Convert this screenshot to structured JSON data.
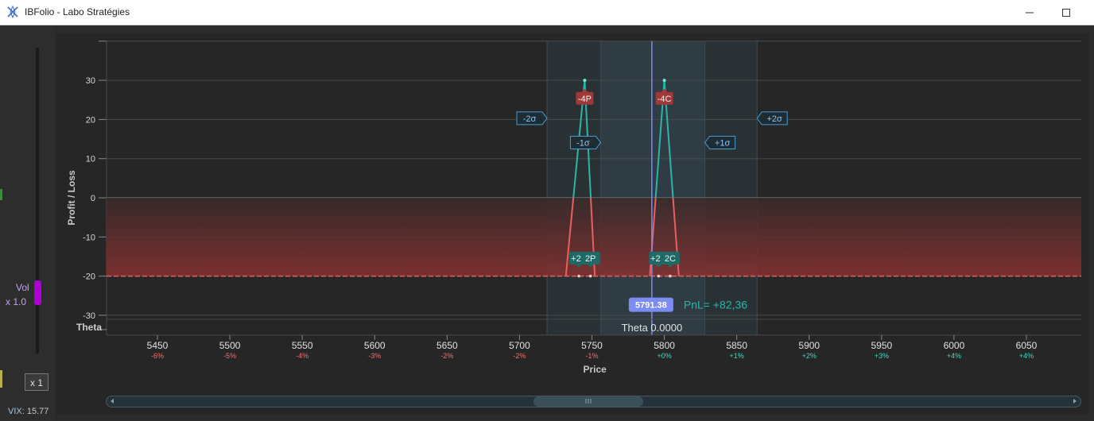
{
  "window": {
    "title": "IBFolio - Labo Stratégies",
    "minimize_icon": "minimize-icon",
    "maximize_icon": "maximize-icon",
    "app_icon": "ibfolio-logo-icon"
  },
  "left_panel": {
    "vol_label": "Vol",
    "vol_multiplier": "x 1.0",
    "vol_level": 0.27,
    "slider_color": "#b000d8",
    "x1_button": "x 1",
    "vix_label": "VIX:",
    "vix_value": "15.77"
  },
  "chart_data": {
    "type": "line",
    "ylabel": "Profit / Loss",
    "xlabel": "Price",
    "ylim": [
      -30,
      30
    ],
    "yticks": [
      30,
      20,
      10,
      0,
      -10,
      -20,
      -30
    ],
    "xlim": [
      5415,
      6090
    ],
    "xticks": [
      5450,
      5500,
      5550,
      5600,
      5650,
      5700,
      5750,
      5800,
      5850,
      5900,
      5950,
      6000,
      6050
    ],
    "xpct": [
      "-6%",
      "-5%",
      "-4%",
      "-3%",
      "-2%",
      "-2%",
      "-1%",
      "+0%",
      "+1%",
      "+2%",
      "+3%",
      "+4%",
      "+4%"
    ],
    "pnl_curve": {
      "x": [
        5415,
        5732,
        5745,
        5752,
        5787,
        5790,
        5800,
        5810,
        6090
      ],
      "y": [
        -20,
        -20,
        30,
        -20,
        -20,
        -20,
        30,
        -20,
        -20
      ]
    },
    "current_price": 5791.38,
    "current_price_label": "5791.38",
    "pnl_label": "PnL= +82,36",
    "theta_label": "Theta",
    "theta_value_label": "Theta 0.0000",
    "sigma_bands": [
      {
        "label": "-2σ",
        "price": 5719
      },
      {
        "label": "-1σ",
        "price": 5756
      },
      {
        "label": "+1σ",
        "price": 5828
      },
      {
        "label": "+2σ",
        "price": 5864
      }
    ],
    "legs": [
      {
        "label": "-4P",
        "strike": 5745,
        "type": "short"
      },
      {
        "label": "-4C",
        "strike": 5800,
        "type": "short"
      },
      {
        "label": "+2P",
        "strike": 5741,
        "type": "long"
      },
      {
        "label": "2P",
        "strike": 5749,
        "type": "long"
      },
      {
        "label": "+2C",
        "strike": 5796,
        "type": "long"
      },
      {
        "label": "2C",
        "strike": 5804,
        "type": "long"
      }
    ],
    "colors": {
      "profit_line": "#2ab5a8",
      "loss_line": "#e86060",
      "loss_fill": "#8a3030",
      "short_leg": "#a03838",
      "long_leg": "#1f6a66",
      "sigma": "#4a9ad0",
      "price_line": "#7c8cf0",
      "pnl_text": "#2ab5a8",
      "pos_pct": "#40d8c8",
      "neg_pct": "#f07070"
    },
    "grid": true
  }
}
